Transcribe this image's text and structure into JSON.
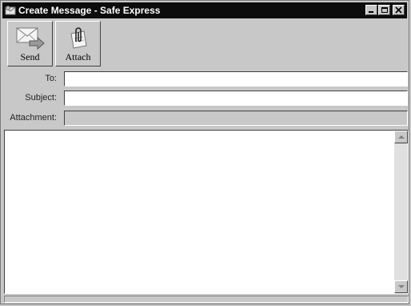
{
  "window": {
    "title": "Create Message - Safe Express"
  },
  "toolbar": {
    "send_label": "Send",
    "attach_label": "Attach"
  },
  "form": {
    "to_label": "To:",
    "to_value": "",
    "subject_label": "Subject:",
    "subject_value": "",
    "attachment_label": "Attachment:",
    "attachment_value": ""
  },
  "message": {
    "body": ""
  },
  "icons": {
    "app": "mail-app-icon",
    "send": "envelope-arrow-icon",
    "attach": "paperclip-document-icon",
    "minimize": "minimize-icon",
    "maximize": "maximize-icon",
    "close": "close-icon"
  }
}
